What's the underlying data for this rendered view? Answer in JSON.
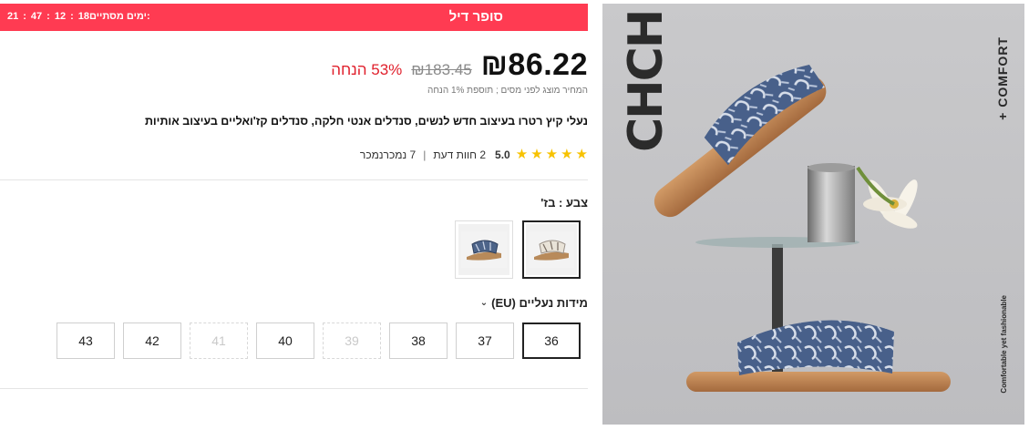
{
  "deal": {
    "title": "סופר דיל",
    "ends_label": "מסתיים:",
    "days": "18ימים",
    "hours": "12",
    "minutes": "47",
    "seconds": "21"
  },
  "price": {
    "current": "86.22",
    "currency": "₪",
    "original": "₪183.45",
    "discount": "53% הנחה",
    "tax_note": "המחיר מוצג לפני מסים ; תוספת 1% הנחה"
  },
  "product": {
    "title": "נעלי קיץ רטרו בעיצוב חדש לנשים, סנדלים אנטי חלקה, סנדלים קז'ואליים בעיצוב אותיות"
  },
  "rating": {
    "value": "5.0",
    "reviews": "2 חוות דעת",
    "sold": "7 נמכרנמכר"
  },
  "color": {
    "label": "צבע : בז'",
    "options": [
      {
        "name": "beige",
        "selected": true
      },
      {
        "name": "blue",
        "selected": false
      }
    ]
  },
  "sizes": {
    "label": "מידות נעליים (EU)",
    "options": [
      {
        "label": "36",
        "state": "selected"
      },
      {
        "label": "37",
        "state": "available"
      },
      {
        "label": "38",
        "state": "available"
      },
      {
        "label": "39",
        "state": "disabled"
      },
      {
        "label": "40",
        "state": "available"
      },
      {
        "label": "41",
        "state": "disabled"
      },
      {
        "label": "42",
        "state": "available"
      },
      {
        "label": "43",
        "state": "available"
      }
    ]
  },
  "image": {
    "brand_text": "CHCH",
    "comfort_text": "+ COMFORT",
    "tagline": "Comfortable yet fashionable"
  },
  "colors": {
    "deal_bar": "#ff3b52",
    "discount": "#e0202c",
    "star": "#f7c200"
  }
}
